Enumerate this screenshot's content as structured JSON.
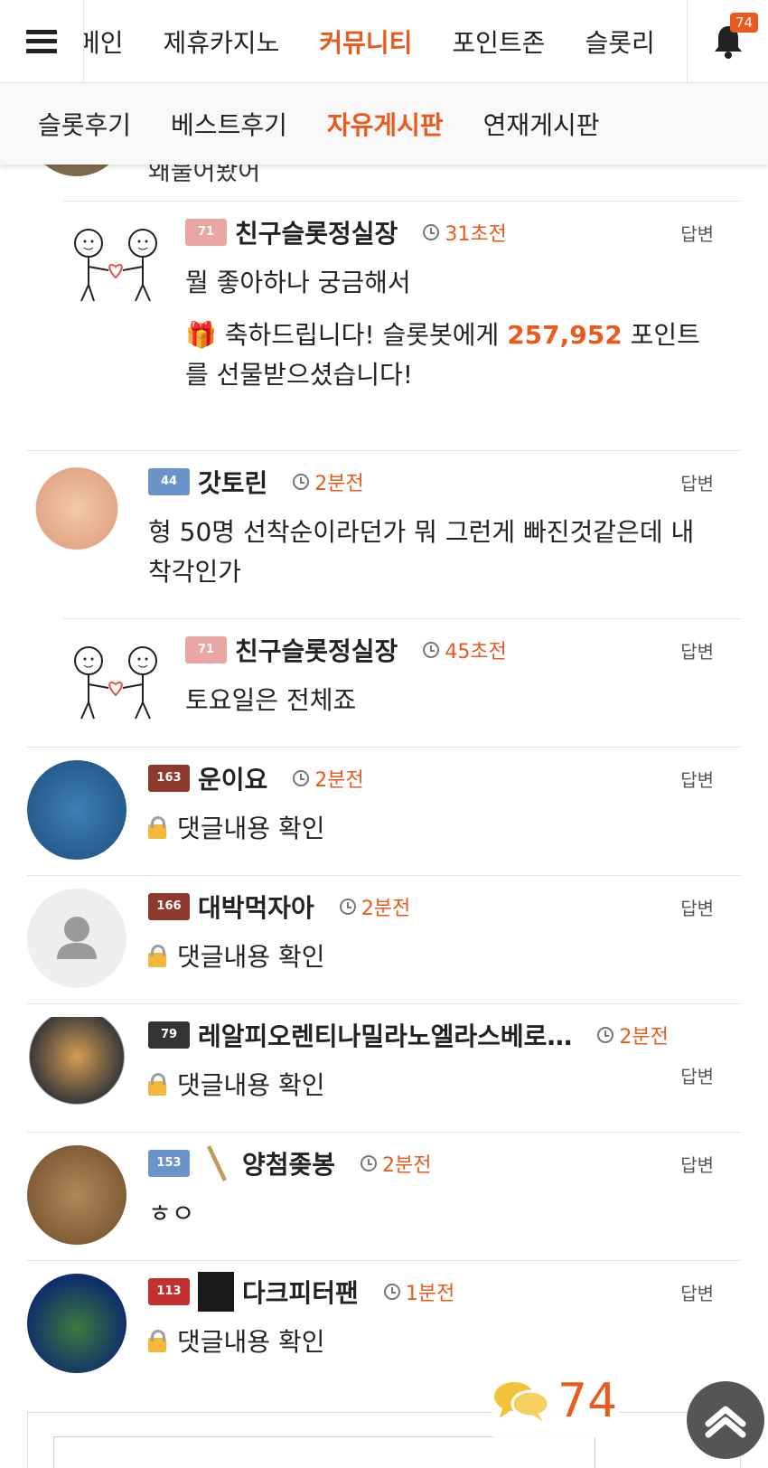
{
  "topnav": {
    "tabs": [
      "메인",
      "제휴카지노",
      "커뮤니티",
      "포인트존",
      "슬롯리"
    ],
    "active_tab": "커뮤니티",
    "notification_count": "74"
  },
  "subnav": {
    "items": [
      "슬롯후기",
      "베스트후기",
      "자유게시판",
      "연재게시판"
    ],
    "active": "자유게시판"
  },
  "previous_tail": {
    "text": "왜물어봤어"
  },
  "comments": [
    {
      "type": "reply",
      "level": "71",
      "nickname": "친구슬롯정실장",
      "time": "31초전",
      "reply_label": "답변",
      "text": "뭘 좋아하나 궁금해서",
      "gift_prefix": "축하드립니다! 슬롯봇에게",
      "gift_points": "257,952",
      "gift_suffix": "포인트를 선물받으셨습니다!"
    },
    {
      "type": "comment",
      "level": "44",
      "nickname": "갓토린",
      "time": "2분전",
      "reply_label": "답변",
      "text": "형 50명 선착순이라던가 뭐 그런게 빠진것같은데 내 착각인가"
    },
    {
      "type": "reply",
      "level": "71",
      "nickname": "친구슬롯정실장",
      "time": "45초전",
      "reply_label": "답변",
      "text": "토요일은 전체죠"
    },
    {
      "type": "comment",
      "level": "163",
      "nickname": "운이요",
      "time": "2분전",
      "reply_label": "답변",
      "text": "댓글내용 확인",
      "locked": true
    },
    {
      "type": "comment",
      "level": "166",
      "nickname": "대박먹자아",
      "time": "2분전",
      "reply_label": "답변",
      "text": "댓글내용 확인",
      "locked": true
    },
    {
      "type": "comment",
      "level": "79",
      "nickname": "레알피오렌티나밀라노엘라스베로…",
      "time": "2분전",
      "reply_label": "답변",
      "text": "댓글내용 확인",
      "locked": true
    },
    {
      "type": "comment",
      "level": "153",
      "nickname": "양첨좆봉",
      "time": "2분전",
      "reply_label": "답변",
      "text": "ㅎㅇ"
    },
    {
      "type": "comment",
      "level": "113",
      "nickname": "다크피터팬",
      "time": "1분전",
      "reply_label": "답변",
      "text": "댓글내용 확인",
      "locked": true
    }
  ],
  "comment_count": "74",
  "colors": {
    "accent": "#ea5a1e"
  }
}
